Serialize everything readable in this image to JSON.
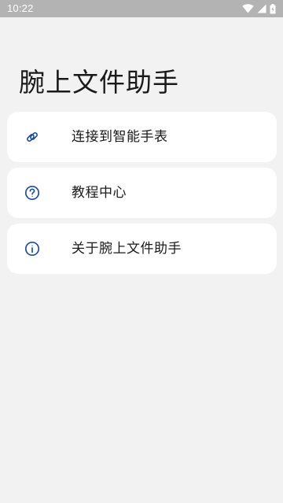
{
  "status_bar": {
    "time": "10:22",
    "icons": [
      "wifi-icon",
      "cellular-signal-icon",
      "battery-charging-icon"
    ]
  },
  "page": {
    "title": "腕上文件助手"
  },
  "menu": {
    "items": [
      {
        "icon": "link-icon",
        "label": "连接到智能手表"
      },
      {
        "icon": "help-circle-icon",
        "label": "教程中心"
      },
      {
        "icon": "info-circle-icon",
        "label": "关于腕上文件助手"
      }
    ]
  },
  "colors": {
    "status_bar": "#b3b3b3",
    "background": "#f2f2f2",
    "card": "#ffffff",
    "accent_icon": "#1e4f9c",
    "text": "#1a1a1a"
  }
}
